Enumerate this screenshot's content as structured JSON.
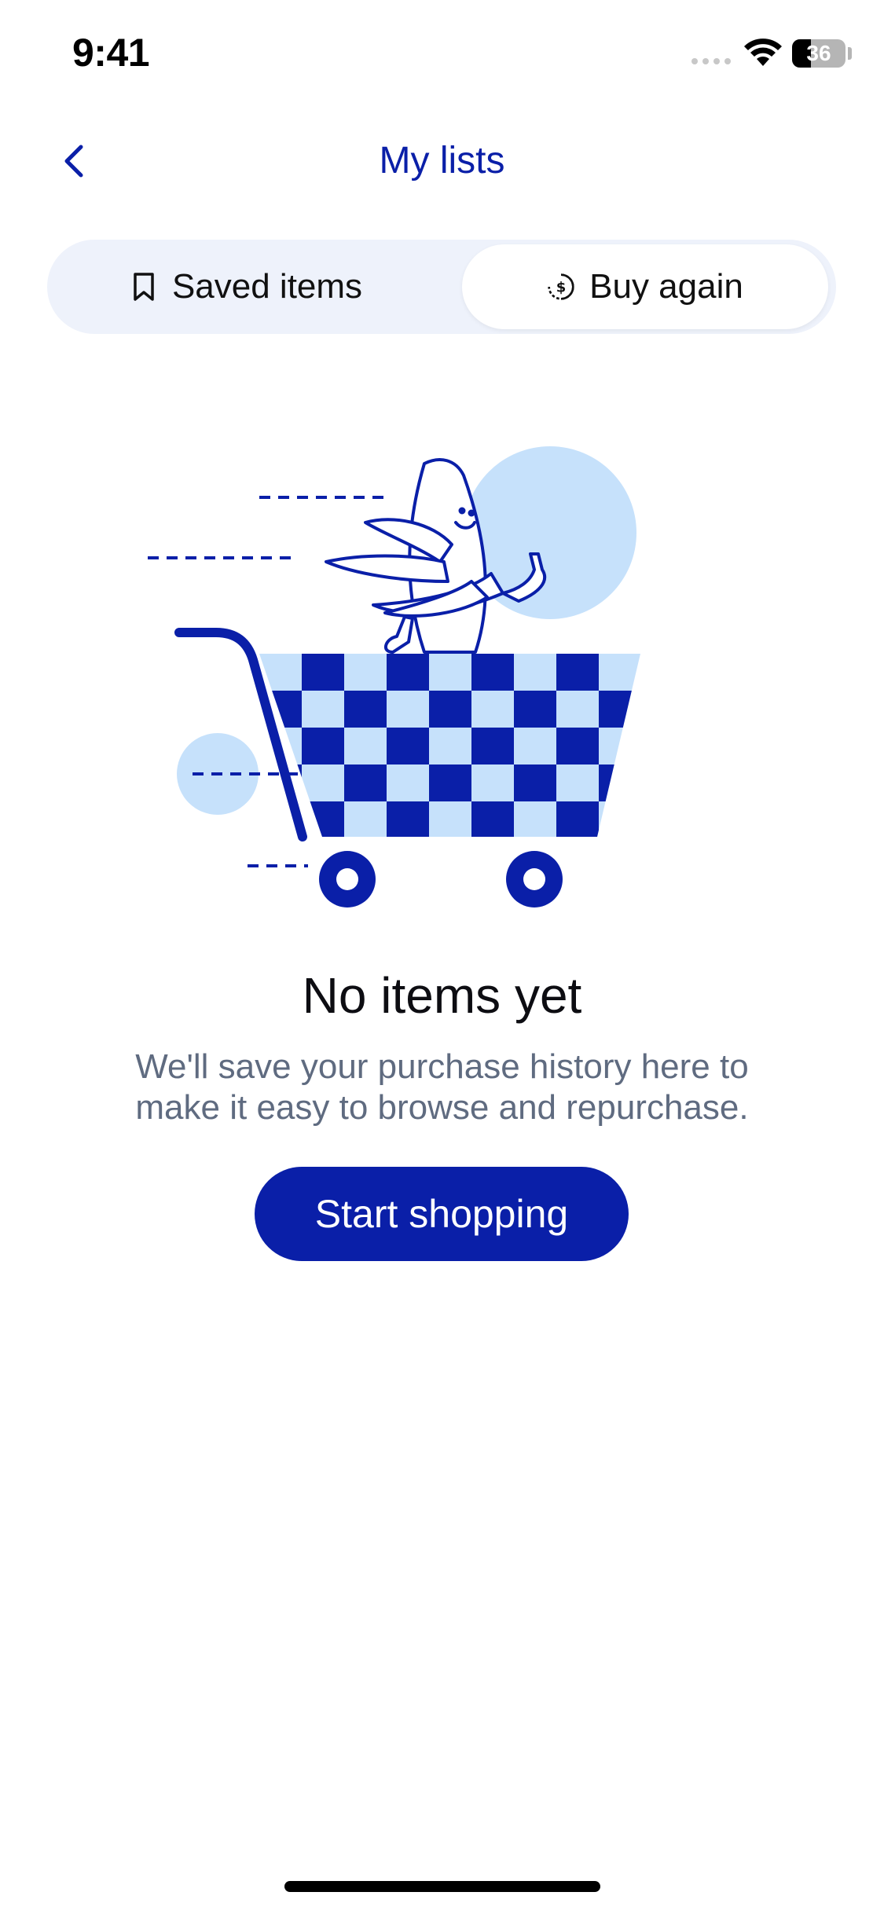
{
  "status_bar": {
    "time": "9:41",
    "battery_percent": "36",
    "battery_level": 0.36
  },
  "header": {
    "back_icon": "chevron-left-icon",
    "title": "My lists"
  },
  "tabs": [
    {
      "label": "Saved items",
      "icon": "bookmark-icon",
      "selected": false
    },
    {
      "label": "Buy again",
      "icon": "dollar-clock-icon",
      "selected": true
    }
  ],
  "empty_state": {
    "illustration": "banana-in-shopping-cart",
    "title": "No items yet",
    "description": "We'll save your purchase history here to make it easy to browse and repurchase.",
    "button_label": "Start shopping"
  },
  "colors": {
    "brand": "#0a1fa8",
    "light_blue": "#c6e1fb",
    "segment_bg": "#eef2fb",
    "muted_text": "#5f6b80"
  }
}
